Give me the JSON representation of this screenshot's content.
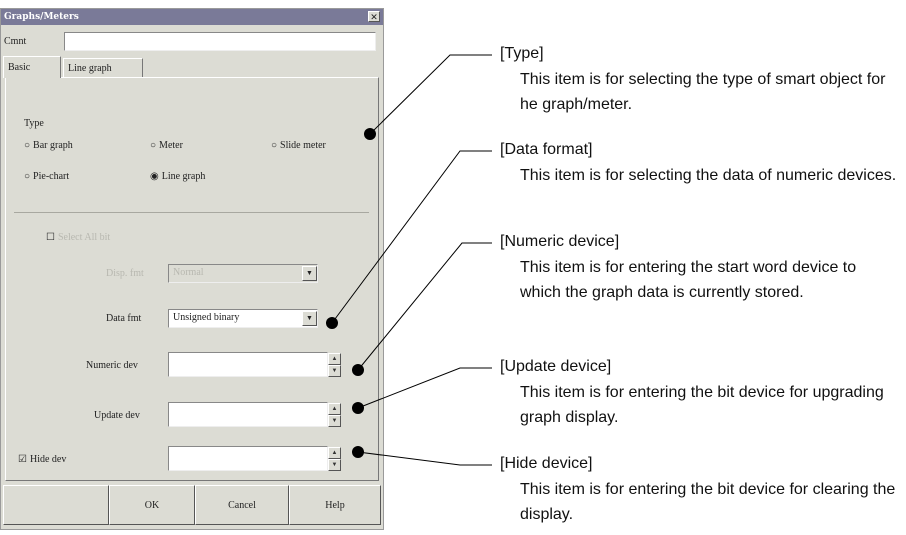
{
  "dialog": {
    "title": "Graphs/Meters",
    "close_glyph": "✕",
    "comment_label": "Cmnt",
    "tabs": [
      "Basic",
      "Line graph"
    ],
    "type_group_label": "Type",
    "type_options": [
      "Bar graph",
      "Meter",
      "Slide meter",
      "Pie-chart",
      "Line graph"
    ],
    "type_selected": "Line graph",
    "select_all_label": "Select All bit",
    "display_label": "Disp. fmt",
    "display_value": "Normal",
    "data_format_label": "Data fmt",
    "data_format_value": "Unsigned binary",
    "numeric_label": "Numeric dev",
    "update_label": "Update dev",
    "hide_label": "Hide dev",
    "hide_checked": true,
    "buttons": {
      "ok": "OK",
      "cancel": "Cancel",
      "help": "Help"
    }
  },
  "annotations": [
    {
      "head": "[Type]",
      "body": "This item is for selecting the type of smart object for he graph/meter."
    },
    {
      "head": "[Data format]",
      "body": "This item is for selecting the data of numeric devices."
    },
    {
      "head": "[Numeric device]",
      "body": "This item is for entering the start word device to which the graph data is currently stored."
    },
    {
      "head": "[Update device]",
      "body": "This item is for entering the bit device for upgrading graph display."
    },
    {
      "head": "[Hide device]",
      "body": "This item is for entering the bit device for clearing the display."
    }
  ]
}
